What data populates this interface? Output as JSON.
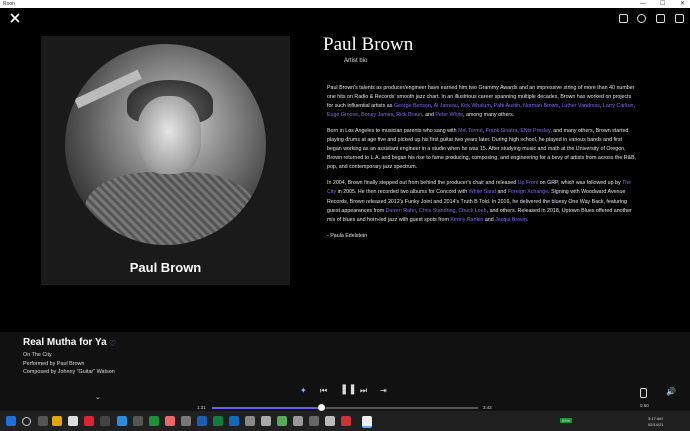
{
  "window": {
    "app_name": "Roon",
    "minimize": "—",
    "maximize": "☐",
    "close": "✕"
  },
  "artist": {
    "name": "Paul Brown",
    "image_caption": "Paul Brown",
    "subtitle": "Artist bio"
  },
  "bio": {
    "p1": [
      {
        "t": "Paul Brown's talents as producer/engineer have earned him two Grammy Awards and an impressive string of more than 40 number one hits on Radio & Records' smooth jazz chart. In an illustrious career spanning multiple decades, Brown has worked on projects for such influential artists as "
      },
      {
        "t": "George Benson",
        "link": true
      },
      {
        "t": ", "
      },
      {
        "t": "Al Jarreau",
        "link": true
      },
      {
        "t": ", "
      },
      {
        "t": "Kirk Whalum",
        "link": true
      },
      {
        "t": ", "
      },
      {
        "t": "Patti Austin",
        "link": true
      },
      {
        "t": ", "
      },
      {
        "t": "Norman Brown",
        "link": true
      },
      {
        "t": ", "
      },
      {
        "t": "Luther Vandross",
        "link": true
      },
      {
        "t": ", "
      },
      {
        "t": "Larry Carlton",
        "link": true
      },
      {
        "t": ", "
      },
      {
        "t": "Euge Groove",
        "link": true
      },
      {
        "t": ", "
      },
      {
        "t": "Boney James",
        "link": true
      },
      {
        "t": ", "
      },
      {
        "t": "Rick Braun",
        "link": true
      },
      {
        "t": ", and "
      },
      {
        "t": "Peter White",
        "link": true
      },
      {
        "t": ", among many others."
      }
    ],
    "p2": [
      {
        "t": "Born in Los Angeles to musician parents who sang with "
      },
      {
        "t": "Mel Tormé",
        "link": true
      },
      {
        "t": ", "
      },
      {
        "t": "Frank Sinatra",
        "link": true
      },
      {
        "t": ", "
      },
      {
        "t": "Elvis Presley",
        "link": true
      },
      {
        "t": ", and many others, Brown started playing drums at age five and picked up his first guitar two years later. During high school, he played in various bands and first began working as an assistant engineer in a studio when he was 15. After studying music and math at the University of Oregon, Brown returned to L.A. and began his rise to fame producing, composing, and engineering for a bevy of artists from across the R&B, pop, and contemporary jazz spectrum."
      }
    ],
    "p3": [
      {
        "t": "In 2004, Brown finally stepped out from behind the producer's chair and released "
      },
      {
        "t": "Up Front",
        "link": true
      },
      {
        "t": " on GRP, which was followed up by "
      },
      {
        "t": "The City",
        "link": true
      },
      {
        "t": " in 2005. He then recorded two albums for Concord with "
      },
      {
        "t": "White Sand",
        "link": true
      },
      {
        "t": " and "
      },
      {
        "t": "Foreign Xchange",
        "link": true
      },
      {
        "t": ". Signing with Woodward Avenue Records, Brown released 2012's Funky Joint and 2014's Truth B Told. In 2016, he delivered the bluesy One Way Back, featuring guest appearances from "
      },
      {
        "t": "Darren Rahn",
        "link": true
      },
      {
        "t": ", "
      },
      {
        "t": "Chris Standring",
        "link": true
      },
      {
        "t": ", "
      },
      {
        "t": "Chuck Loeb",
        "link": true
      },
      {
        "t": ", and others. Released in 2018, Uptown Blues offered another mix of blues and horn-led jazz with guest spots from "
      },
      {
        "t": "Kenny Rankin",
        "link": true
      },
      {
        "t": " and "
      },
      {
        "t": "Jacqui Brown",
        "link": true
      },
      {
        "t": "."
      }
    ],
    "signature": "- Paula Edelstein"
  },
  "now_playing": {
    "title": "Real Mutha for Ya",
    "album": "On The City",
    "performed_by": "Performed by Paul Brown",
    "composed_by": "Composed by Johnny \"Guitar\" Watson",
    "elapsed": "1:31",
    "duration": "3:42",
    "progress": 0.41,
    "volume_label": "0.50"
  },
  "tray": {
    "time": "3:17 AM",
    "date": "02/14/21",
    "battery": "55%"
  },
  "colors": {
    "accent": "#7b6cf0",
    "background": "#000000",
    "player": "#111111",
    "taskbar": "#202020"
  }
}
